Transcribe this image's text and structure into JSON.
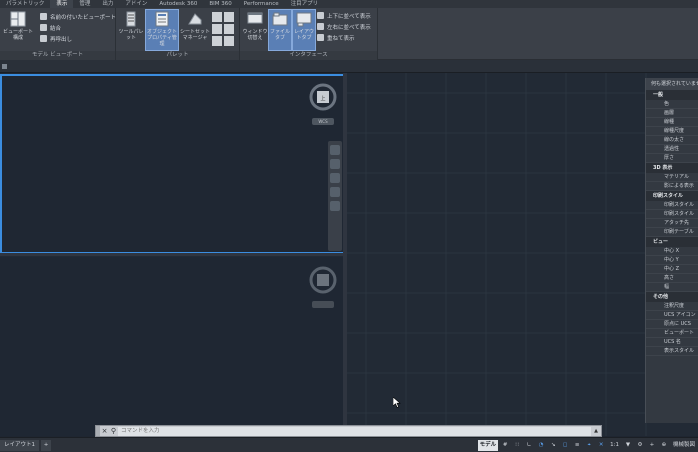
{
  "ribbon": {
    "tabs": [
      "パラメトリック",
      "表示",
      "管理",
      "出力",
      "アドイン",
      "Autodesk 360",
      "BIM 360",
      "Performance",
      "注目アプリ"
    ],
    "active_tab_index": 1,
    "panels": {
      "model_viewports": {
        "title": "モデル ビューポート",
        "viewport_config": "ビューポート構成",
        "named_views": "名前の付いたビューポート",
        "join": "結合",
        "restore": "再呼出し"
      },
      "palettes": {
        "title": "パレット",
        "tool_palette": "ツールパレット",
        "properties": "オブジェクトプロパティ管理",
        "sheet_set": "シートセットマネージャ"
      },
      "interface": {
        "title": "インタフェース",
        "switch_windows": "ウィンドウ切替え",
        "file_tabs": "ファイルタブ",
        "layout_tabs": "レイアウトタブ",
        "tile_horizontal": "上下に並べて表示",
        "tile_vertical": "左右に並べて表示",
        "cascade": "重ねて表示"
      }
    }
  },
  "viewports": {
    "top_ucs_label": "WCS"
  },
  "properties_palette": {
    "title": "何も選択されていません",
    "sections": [
      {
        "name": "一般",
        "rows": [
          "色",
          "画層",
          "線種",
          "線種尺度",
          "線の太さ",
          "透過性",
          "厚さ"
        ]
      },
      {
        "name": "3D 表示",
        "rows": [
          "マテリアル",
          "影による表示"
        ]
      },
      {
        "name": "印刷スタイル",
        "rows": [
          "印刷スタイル",
          "印刷スタイル",
          "アタッチ先",
          "印刷テーブル"
        ]
      },
      {
        "name": "ビュー",
        "rows": [
          "中心 X",
          "中心 Y",
          "中心 Z",
          "高さ",
          "幅"
        ]
      },
      {
        "name": "その他",
        "rows": [
          "注釈尺度",
          "UCS アイコン",
          "原点に UCS",
          "ビューポート",
          "UCS 名",
          "表示スタイル"
        ]
      }
    ]
  },
  "command_line": {
    "placeholder": "コマンドを入力"
  },
  "status_bar": {
    "tabs": [
      "レイアウト1",
      "+"
    ],
    "model_label": "モデル",
    "right_items": [
      "1:1",
      "▼",
      "⚙",
      "+",
      "⊕"
    ],
    "layout_label": "機械製図"
  },
  "colors": {
    "accent": "#3b8de0",
    "canvas": "#222a35",
    "ribbon": "#3b4048"
  }
}
